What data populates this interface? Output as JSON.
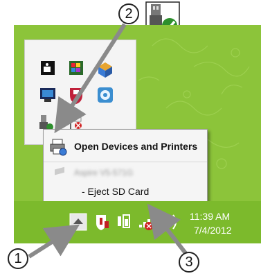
{
  "context_menu": {
    "open_devices_label": "Open Devices and Printers",
    "device_label": "Aspire V5-571G",
    "eject_label": "- Eject SD Card"
  },
  "taskbar": {
    "time": "11:39 AM",
    "date": "7/4/2012"
  },
  "callouts": {
    "one": "1",
    "two": "2",
    "three": "3"
  },
  "colors": {
    "desktop_green": "#8cc43a",
    "taskbar_green": "#7cba2c",
    "arrow_gray": "#8a8a8a"
  },
  "icons": {
    "header": "usb-safely-remove-icon",
    "overflow_button": "chevron-up-icon",
    "tray": [
      "action-center-icon",
      "power-icon",
      "network-icon",
      "volume-icon"
    ]
  }
}
